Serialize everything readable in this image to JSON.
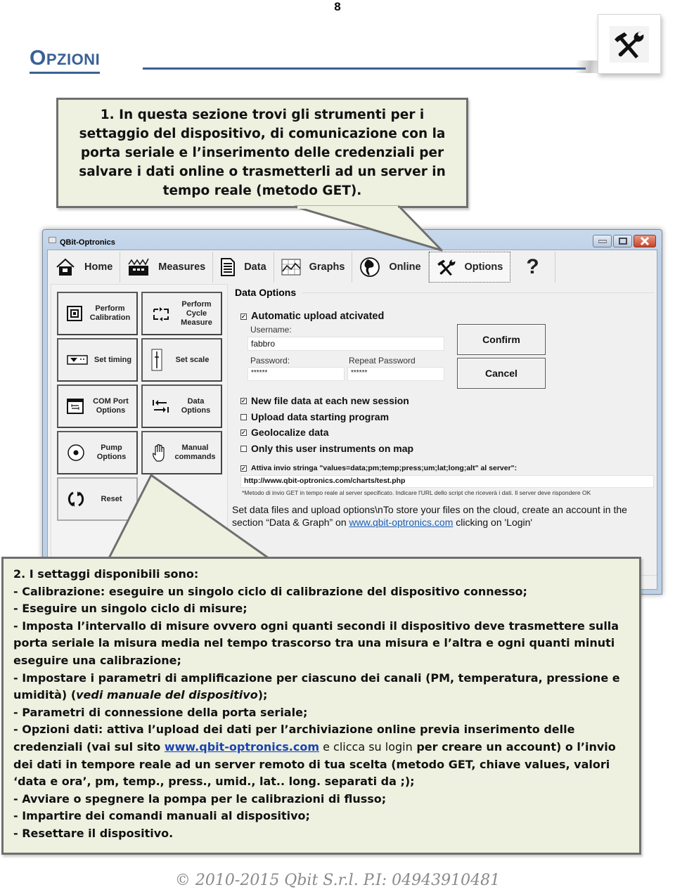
{
  "page": {
    "number": "8",
    "section_title": "Opzioni",
    "section_title_first": "O",
    "section_title_rest": "PZIONI",
    "corner_icon": "tools-icon"
  },
  "callout1": {
    "text": "1. In questa sezione trovi gli strumenti per i settaggio del dispositivo, di comunicazione con la porta seriale e l’inserimento delle credenziali per salvare i dati online o trasmetterli ad un server in tempo reale (metodo GET)."
  },
  "window": {
    "title": "QBit-Optronics",
    "controls": [
      "minimize",
      "maximize",
      "close"
    ],
    "tabs": [
      {
        "label": "Home",
        "icon": "home-icon"
      },
      {
        "label": "Measures",
        "icon": "factory-icon"
      },
      {
        "label": "Data",
        "icon": "document-icon"
      },
      {
        "label": "Graphs",
        "icon": "chart-icon"
      },
      {
        "label": "Online",
        "icon": "globe-icon"
      },
      {
        "label": "Options",
        "icon": "tools-icon",
        "active": true
      },
      {
        "label": "?",
        "icon": "help-icon"
      }
    ],
    "tool_buttons": [
      {
        "label": "Perform Calibration",
        "icon": "calibration-icon"
      },
      {
        "label": "Perform Cycle Measure",
        "icon": "cycle-icon"
      },
      {
        "label": "Set timing",
        "icon": "timing-icon"
      },
      {
        "label": "Set scale",
        "icon": "scale-slider-icon"
      },
      {
        "label": "COM Port Options",
        "icon": "com-port-icon"
      },
      {
        "label": "Data Options",
        "icon": "data-transfer-icon"
      },
      {
        "label": "Pump Options",
        "icon": "pump-icon"
      },
      {
        "label": "Manual commands",
        "icon": "hand-icon"
      },
      {
        "label": "Reset",
        "icon": "reset-icon"
      }
    ],
    "data_options": {
      "legend": "Data Options",
      "auto_upload": {
        "label": "Automatic upload atcivated",
        "checked": true
      },
      "username_label": "Username:",
      "username_value": "fabbro",
      "password_label": "Password:",
      "password_value": "******",
      "repeat_password_label": "Repeat Password",
      "repeat_password_value": "******",
      "confirm_label": "Confirm",
      "cancel_label": "Cancel",
      "checks": [
        {
          "label": "New file data at each new session",
          "checked": true
        },
        {
          "label": "Upload data starting program",
          "checked": false
        },
        {
          "label": "Geolocalize data",
          "checked": true
        },
        {
          "label": "Only this user instruments on map",
          "checked": false
        }
      ],
      "send_string": {
        "label": "Attiva invio stringa \"values=data;pm;temp;press;um;lat;long;alt\" al server\":",
        "checked": true
      },
      "server_url": "http://www.qbit-optronics.com/charts/test.php",
      "server_note": "*Metodo di invio GET in tempo reale al server specificato. Indicare l'URL dello script che riceverà i dati. Il server deve rispondere OK",
      "info_text_1": "Set data files and upload options\\nTo store your files on the cloud, create an account in the section “Data & Graph” on ",
      "info_link": "www.qbit-optronics.com",
      "info_text_2": " clicking on 'Login'"
    }
  },
  "callout2": {
    "heading": "2. I settaggi disponibili sono:",
    "items": [
      "- Calibrazione: eseguire un singolo ciclo di calibrazione del dispositivo connesso;",
      "- Eseguire un singolo ciclo di misure;",
      "- Imposta l’intervallo di misure ovvero ogni quanti secondi il dispositivo deve trasmettere sulla porta seriale la misura media nel tempo trascorso tra una misura e l’altra e ogni quanti minuti eseguire una calibrazione;"
    ],
    "amp_pre": "- Impostare i parametri di amplificazione per ciascuno dei canali (PM, temperatura, pressione e umidità) (",
    "amp_italic": "vedi manuale del dispositivo",
    "amp_post": ");",
    "serial": "- Parametri di connessione della porta seriale;",
    "data_pre": "- Opzioni dati: attiva l’upload dei dati per l’archiviazione online previa inserimento delle credenziali (vai sul sito ",
    "data_link": "www.qbit-optronics.com",
    "data_light": " e clicca su login",
    "data_post": " per creare un account) o l’invio dei dati in tempore reale ad un server remoto di tua scelta (metodo GET, chiave values, valori ‘data e ora’, pm, temp., press., umid., lat.. long. separati da ;);",
    "tail": [
      "- Avviare o spegnere la pompa per le calibrazioni di flusso;",
      "- Impartire dei comandi manuali al dispositivo;",
      "- Resettare il dispositivo."
    ]
  },
  "footer": {
    "text": "© 2010-2015 Qbit S.r.l. P.I: 04943910481"
  }
}
